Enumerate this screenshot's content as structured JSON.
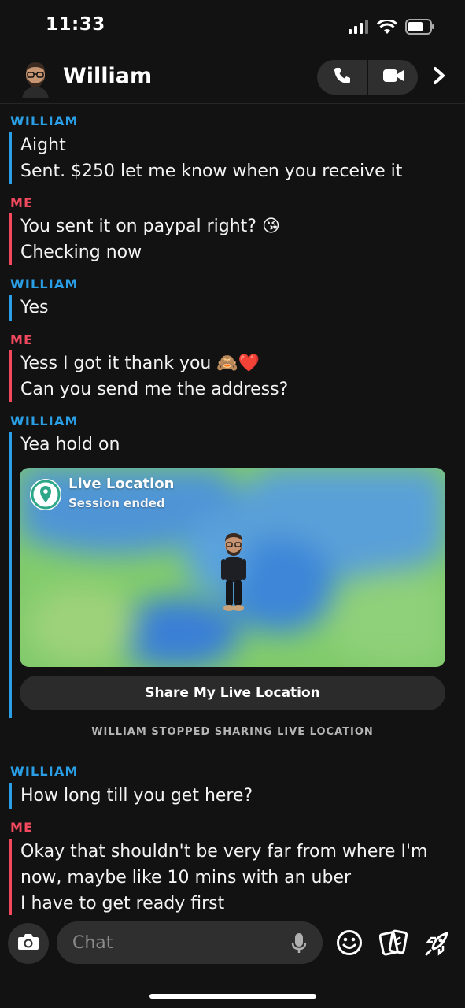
{
  "status_bar": {
    "time": "11:33"
  },
  "header": {
    "contact_name": "William"
  },
  "chat": {
    "messages": [
      {
        "sender": "WILLIAM",
        "lines": [
          "Aight",
          "Sent. $250 let me know when you receive it"
        ]
      },
      {
        "sender": "ME",
        "lines": [
          "You sent it on paypal right? 😘",
          "Checking now"
        ]
      },
      {
        "sender": "WILLIAM",
        "lines": [
          "Yes"
        ]
      },
      {
        "sender": "ME",
        "lines": [
          "Yess I got it thank you 🙈❤️",
          "Can you send me the address?"
        ]
      },
      {
        "sender": "WILLIAM",
        "lines": [
          "Yea hold on"
        ]
      },
      {
        "sender": "WILLIAM",
        "lines": [
          "How long till you get here?"
        ]
      },
      {
        "sender": "ME",
        "lines": [
          "Okay that shouldn't be very far from where I'm",
          "now, maybe like 10 mins with an uber",
          "I have to get ready first"
        ]
      }
    ],
    "live_location": {
      "title": "Live Location",
      "status": "Session ended",
      "share_button": "Share My Live Location"
    },
    "system_note": "WILLIAM STOPPED SHARING LIVE LOCATION"
  },
  "composer": {
    "placeholder": "Chat"
  },
  "colors": {
    "friend": "#2a9fe6",
    "me": "#f2495f",
    "background": "#121212"
  },
  "icons": [
    "signal-icon",
    "wifi-icon",
    "battery-icon",
    "phone-icon",
    "video-icon",
    "chevron-right-icon",
    "camera-icon",
    "mic-icon",
    "smiley-icon",
    "stickers-icon",
    "rocket-icon",
    "location-pin-icon"
  ]
}
